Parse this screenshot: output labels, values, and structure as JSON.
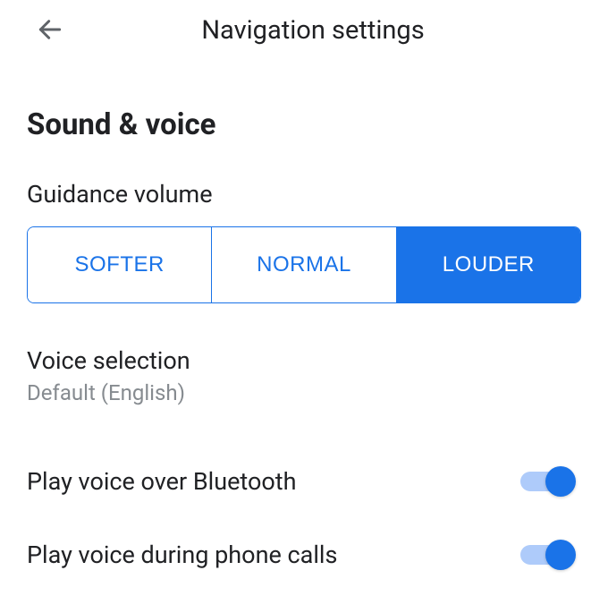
{
  "header": {
    "title": "Navigation settings"
  },
  "section": {
    "title": "Sound & voice"
  },
  "guidance_volume": {
    "label": "Guidance volume",
    "options": {
      "softer": "SOFTER",
      "normal": "NORMAL",
      "louder": "LOUDER"
    },
    "selected": "louder"
  },
  "voice_selection": {
    "title": "Voice selection",
    "value": "Default (English)"
  },
  "bluetooth": {
    "label": "Play voice over Bluetooth",
    "enabled": true
  },
  "phone_calls": {
    "label": "Play voice during phone calls",
    "enabled": true
  },
  "colors": {
    "accent": "#1a73e8",
    "accent_light": "#aecbfa",
    "text_primary": "#202124",
    "text_secondary": "#868b90"
  }
}
